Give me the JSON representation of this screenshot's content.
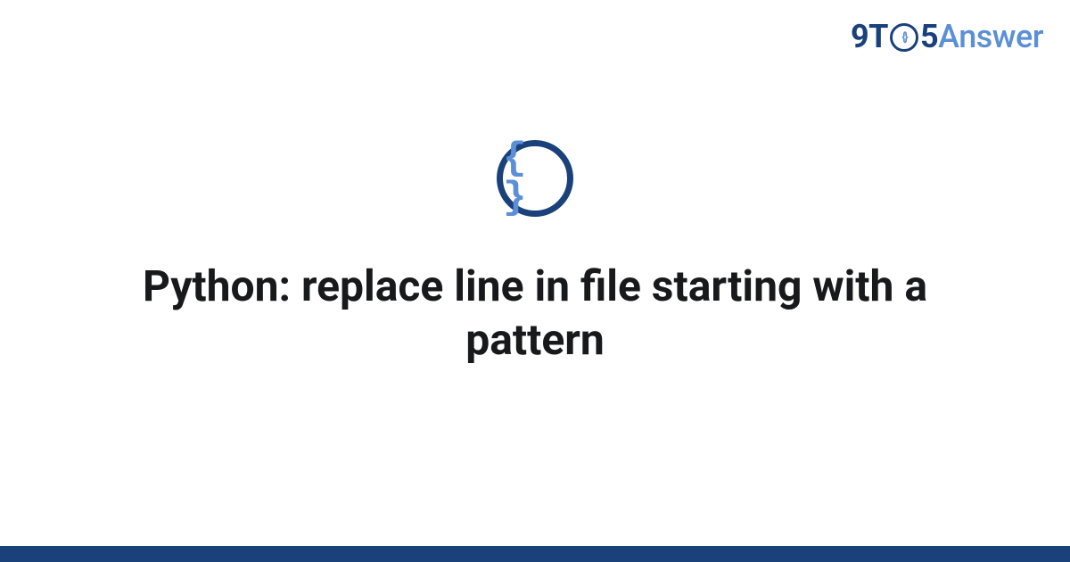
{
  "brand": {
    "prefix": "9T",
    "circle_inner": "{}",
    "suffix_digit": "5",
    "suffix_word": "Answer"
  },
  "icon": {
    "name": "code-braces-icon",
    "glyph": "{ }"
  },
  "title": "Python: replace line in file starting with a pattern",
  "colors": {
    "accent_dark": "#1a417a",
    "accent_light": "#5b8fd6"
  }
}
